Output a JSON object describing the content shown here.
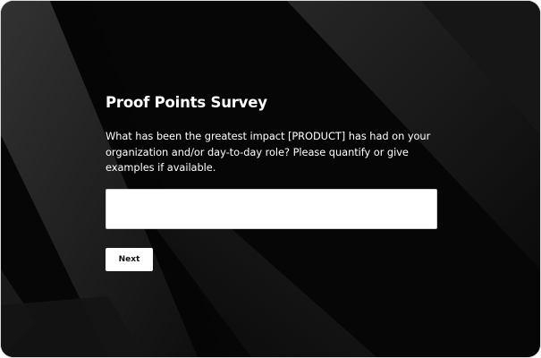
{
  "survey": {
    "title": "Proof Points Survey",
    "question": "What has been the greatest impact [PRODUCT] has had on your organization and/or day-to-day role? Please quantify or give examples if available.",
    "answer_value": "",
    "next_label": "Next"
  },
  "colors": {
    "background": "#070707",
    "text": "#ffffff",
    "input_background": "#ffffff",
    "button_background": "#ffffff",
    "button_text": "#111111"
  }
}
